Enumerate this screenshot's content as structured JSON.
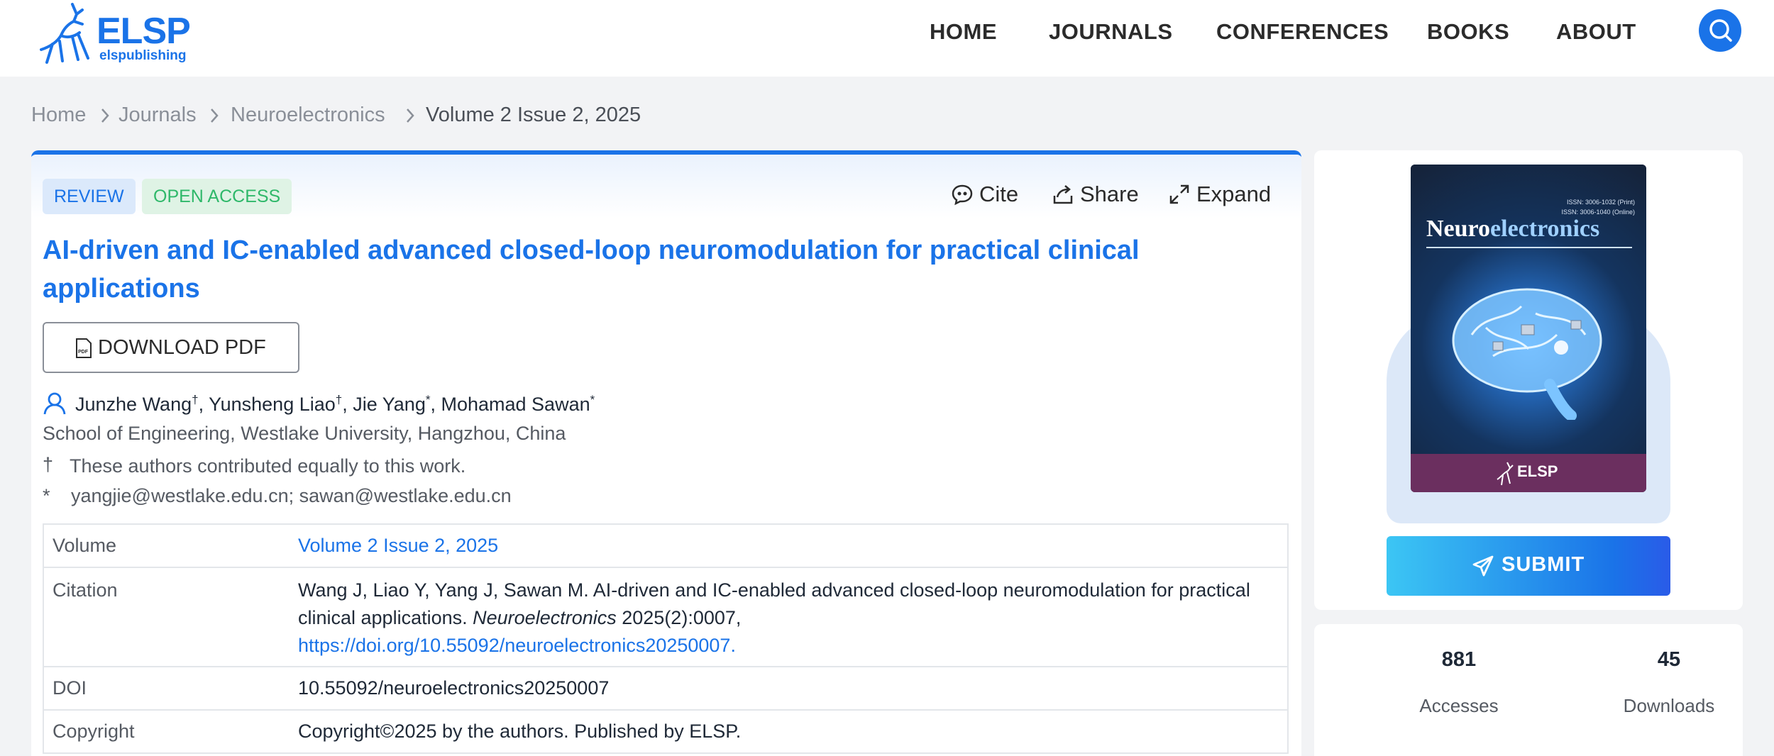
{
  "brand": {
    "name": "ELSP",
    "subtitle": "elspublishing",
    "accent": "#1a73e8"
  },
  "nav": {
    "items": [
      "HOME",
      "JOURNALS",
      "CONFERENCES",
      "BOOKS",
      "ABOUT"
    ],
    "search_icon": "search-icon"
  },
  "breadcrumb": {
    "items": [
      "Home",
      "Journals",
      "Neuroelectronics",
      "Volume 2 Issue 2, 2025"
    ]
  },
  "article": {
    "badges": {
      "type": "REVIEW",
      "access": "OPEN ACCESS"
    },
    "actions": {
      "cite": "Cite",
      "share": "Share",
      "expand": "Expand"
    },
    "title": "AI-driven and IC-enabled advanced closed-loop neuromodulation for practical clinical applications",
    "download_label": "DOWNLOAD PDF",
    "authors": [
      {
        "name": "Junzhe Wang",
        "mark": "†"
      },
      {
        "name": "Yunsheng Liao",
        "mark": "†"
      },
      {
        "name": "Jie Yang",
        "mark": "*"
      },
      {
        "name": "Mohamad Sawan",
        "mark": "*"
      }
    ],
    "affiliation": "School of Engineering, Westlake University, Hangzhou, China",
    "notes": [
      {
        "mark": "†",
        "text": "These authors contributed equally to this work."
      },
      {
        "mark": "*",
        "text": "yangjie@westlake.edu.cn; sawan@westlake.edu.cn"
      }
    ],
    "info": {
      "volume_label": "Volume",
      "volume_value": "Volume 2 Issue 2, 2025",
      "citation_label": "Citation",
      "citation_text": "Wang J, Liao Y, Yang J, Sawan M. AI-driven and IC-enabled advanced closed-loop neuromodulation for practical clinical applications.",
      "citation_journal": "Neuroelectronics",
      "citation_issue": "2025(2):0007,",
      "citation_link": "https://doi.org/10.55092/neuroelectronics20250007.",
      "doi_label": "DOI",
      "doi_value": "10.55092/neuroelectronics20250007",
      "copyright_label": "Copyright",
      "copyright_value": "Copyright©2025 by the authors. Published by ELSP."
    }
  },
  "sidebar": {
    "cover": {
      "journal_name_a": "Neuro",
      "journal_name_b": "electronics",
      "issn_print": "ISSN: 3006-1032 (Print)",
      "issn_online": "ISSN: 3006-1040 (Online)",
      "publisher": "ELSP"
    },
    "submit_label": "SUBMIT",
    "stats": [
      {
        "value": "881",
        "label": "Accesses"
      },
      {
        "value": "45",
        "label": "Downloads"
      }
    ]
  }
}
